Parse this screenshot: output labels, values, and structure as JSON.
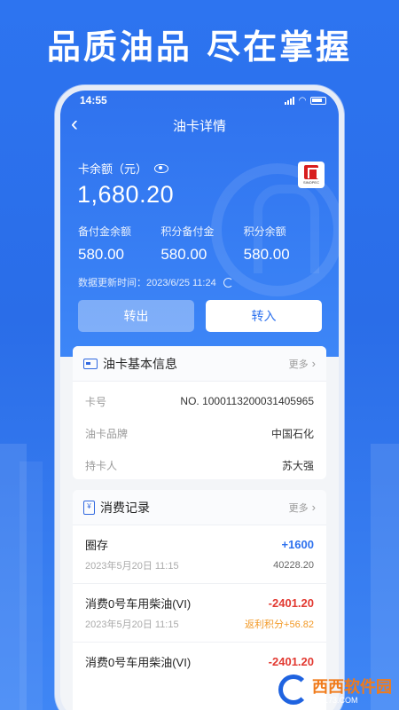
{
  "headline": "品质油品 尽在掌握",
  "status": {
    "time": "14:55"
  },
  "nav": {
    "title": "油卡详情"
  },
  "balance": {
    "label": "卡余额（元）",
    "value": "1,680.20"
  },
  "brand_logo_text": "SINOPEC",
  "sub_balances": [
    {
      "label": "备付金余额",
      "value": "580.00"
    },
    {
      "label": "积分备付金",
      "value": "580.00"
    },
    {
      "label": "积分余额",
      "value": "580.00"
    }
  ],
  "updated": "数据更新时间：2023/6/25 11:24",
  "buttons": {
    "out": "转出",
    "in": "转入"
  },
  "card_info": {
    "title": "油卡基本信息",
    "more": "更多",
    "rows": [
      {
        "key": "卡号",
        "value": "NO. 1000113200031405965"
      },
      {
        "key": "油卡品牌",
        "value": "中国石化"
      },
      {
        "key": "持卡人",
        "value": "苏大强"
      }
    ]
  },
  "records": {
    "title": "消费记录",
    "more": "更多",
    "icon_text": "¥",
    "items": [
      {
        "name": "圈存",
        "date": "2023年5月20日 11:15",
        "amount": "+1600",
        "sub": "40228.20",
        "type": "pos"
      },
      {
        "name": "消费0号车用柴油(VI)",
        "date": "2023年5月20日 11:15",
        "amount": "-2401.20",
        "sub": "返利积分+56.82",
        "type": "neg"
      },
      {
        "name": "消费0号车用柴油(VI)",
        "date": "",
        "amount": "-2401.20",
        "sub": "",
        "type": "neg"
      }
    ]
  },
  "corner_logo": {
    "name": "西西软件园",
    "domain": "CR173.COM"
  },
  "colors": {
    "primary": "#2f72ee",
    "negative": "#e23a32",
    "bonus": "#f29a28"
  }
}
